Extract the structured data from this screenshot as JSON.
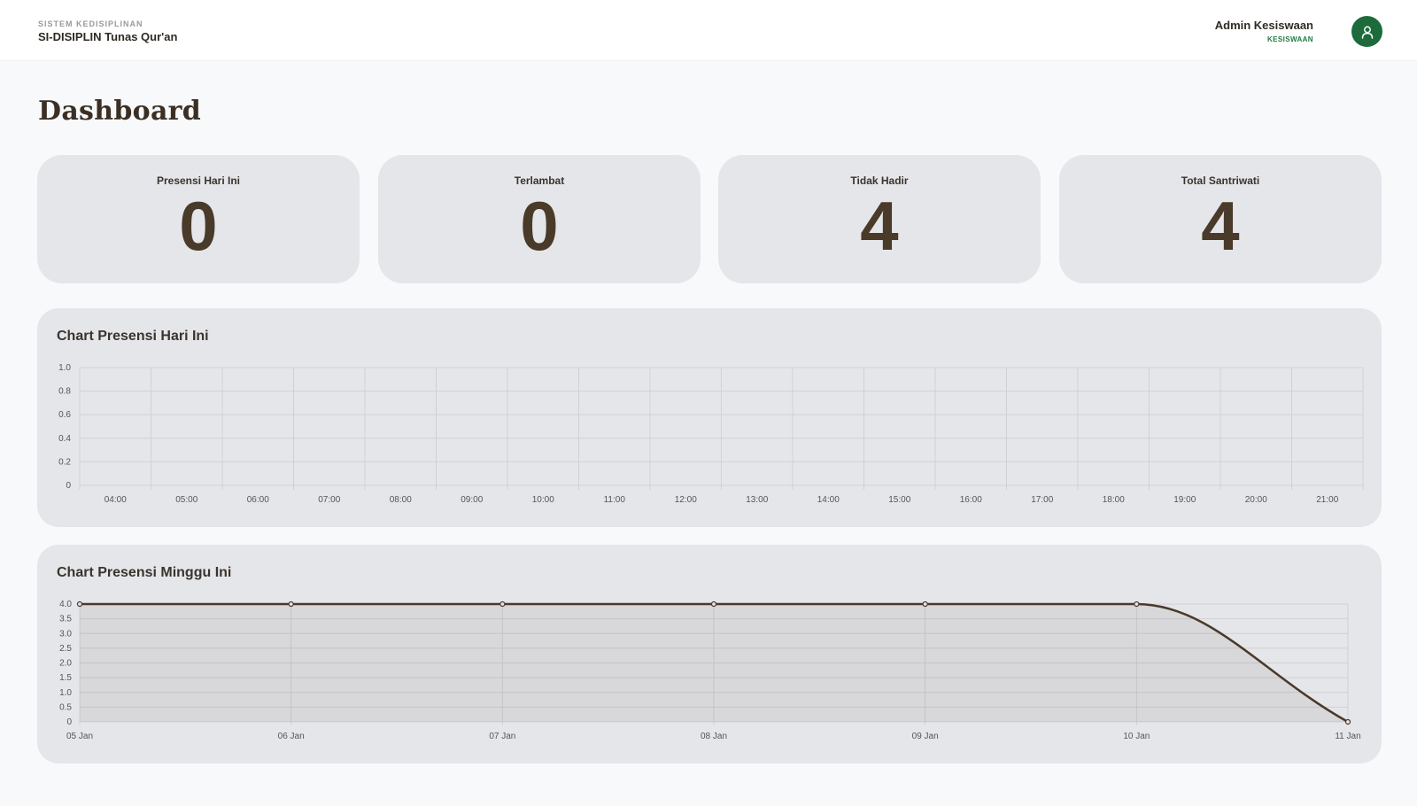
{
  "app": {
    "subtitle": "SISTEM KEDISIPLINAN",
    "title": "SI-DISIPLIN Tunas Qur'an"
  },
  "user": {
    "name": "Admin Kesiswaan",
    "role": "KESISWAAN",
    "avatar_icon": "user-icon"
  },
  "page": {
    "title": "Dashboard"
  },
  "stats": [
    {
      "label": "Presensi Hari Ini",
      "value": "0"
    },
    {
      "label": "Terlambat",
      "value": "0"
    },
    {
      "label": "Tidak Hadir",
      "value": "4"
    },
    {
      "label": "Total Santriwati",
      "value": "4"
    }
  ],
  "colors": {
    "brand_green": "#1d6b3a",
    "role_green": "#1f7a3e",
    "value_brown": "#4a3a2a",
    "card_bg": "#e5e6ea",
    "line": "#4a3a2a"
  },
  "chart_data": [
    {
      "type": "line",
      "title": "Chart Presensi Hari Ini",
      "x": [
        "04:00",
        "05:00",
        "06:00",
        "07:00",
        "08:00",
        "09:00",
        "10:00",
        "11:00",
        "12:00",
        "13:00",
        "14:00",
        "15:00",
        "16:00",
        "17:00",
        "18:00",
        "19:00",
        "20:00",
        "21:00"
      ],
      "yticks": [
        "0",
        "0.2",
        "0.4",
        "0.6",
        "0.8",
        "1.0"
      ],
      "ylim": [
        0,
        1
      ],
      "series": [],
      "grid": true
    },
    {
      "type": "area",
      "title": "Chart Presensi Minggu Ini",
      "x": [
        "05 Jan",
        "06 Jan",
        "07 Jan",
        "08 Jan",
        "09 Jan",
        "10 Jan",
        "11 Jan"
      ],
      "yticks": [
        "0",
        "0.5",
        "1.0",
        "1.5",
        "2.0",
        "2.5",
        "3.0",
        "3.5",
        "4.0"
      ],
      "ylim": [
        0,
        4
      ],
      "series": [
        {
          "values": [
            4,
            4,
            4,
            4,
            4,
            4,
            0
          ]
        }
      ],
      "grid": true
    }
  ]
}
